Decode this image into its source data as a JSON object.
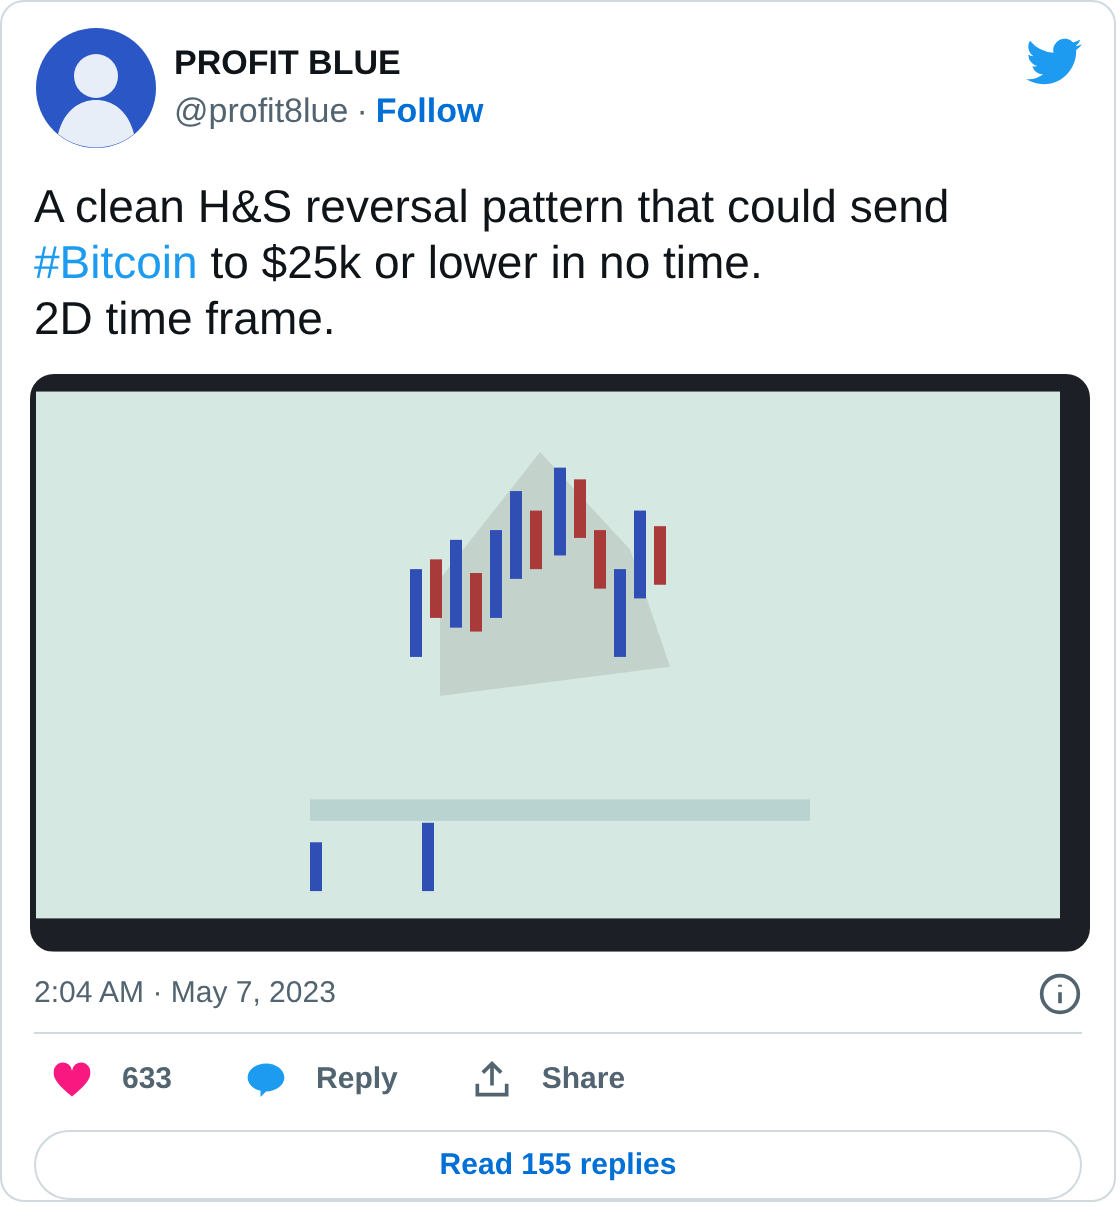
{
  "author": {
    "name": "PROFIT BLUE",
    "handle": "@profit8lue",
    "separator": "·",
    "follow": "Follow"
  },
  "tweet": {
    "text_before": "A clean H&S reversal pattern that could send\n",
    "hashtag": "#Bitcoin",
    "text_after": " to $25k or lower in no time.\n2D time frame."
  },
  "timestamp": "2:04 AM · May 7, 2023",
  "actions": [
    {
      "kind": "like",
      "label": "633"
    },
    {
      "kind": "reply",
      "label": "Reply"
    },
    {
      "kind": "share",
      "label": "Share"
    }
  ],
  "read_replies": "Read 155 replies"
}
